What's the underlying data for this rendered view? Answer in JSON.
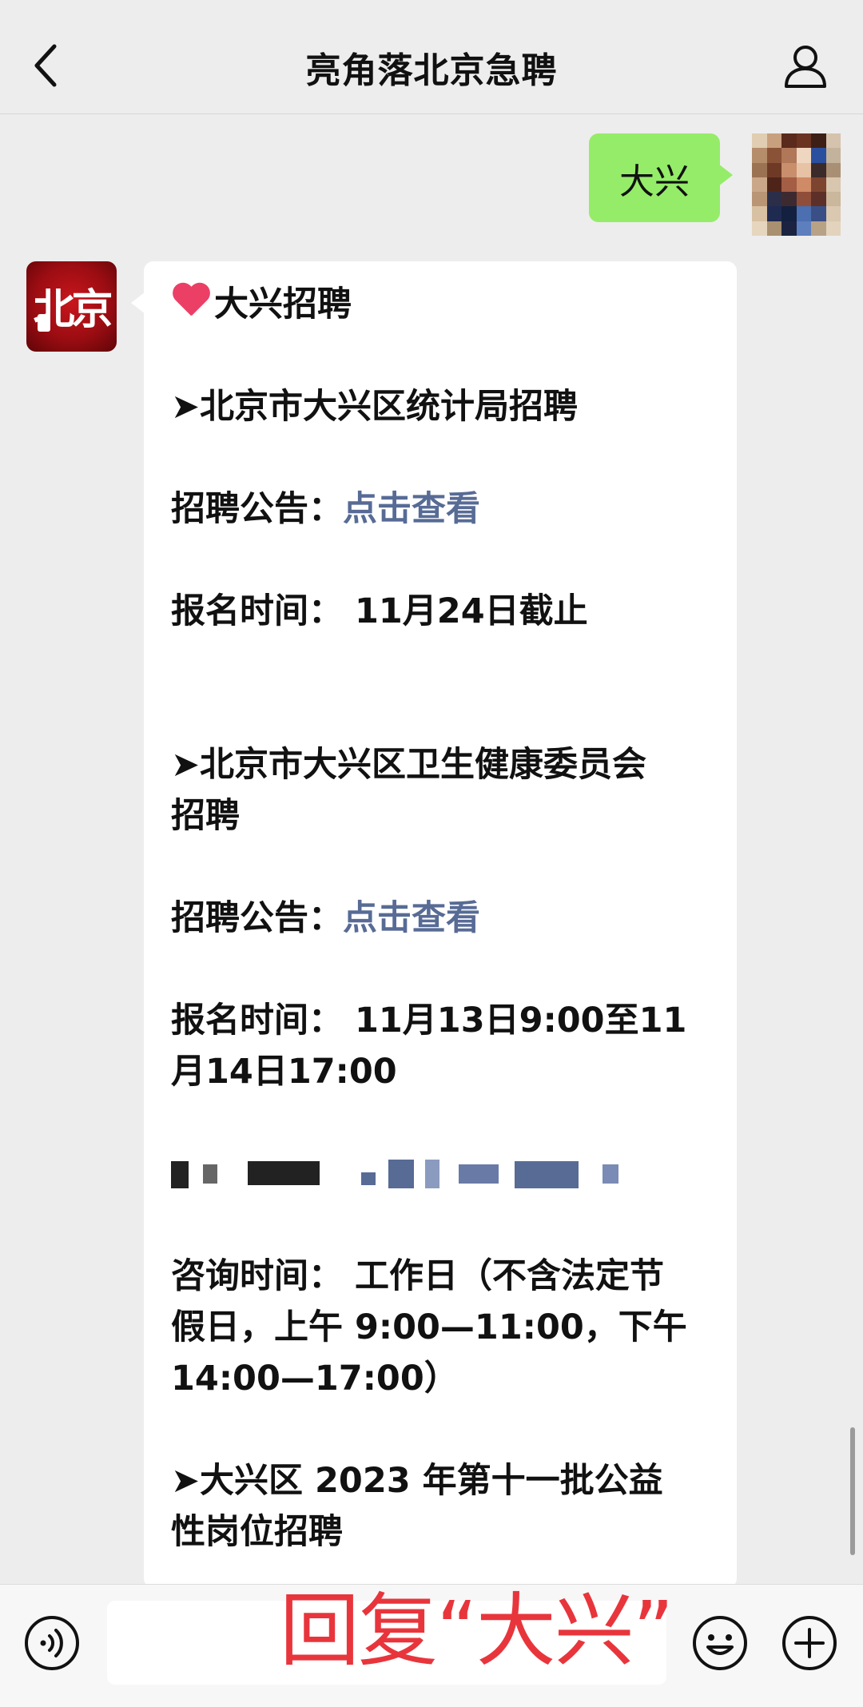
{
  "header": {
    "title": "亮角落北京急聘",
    "back_icon": "chevron-left-icon",
    "profile_icon": "person-icon"
  },
  "chat": {
    "outgoing": {
      "text": "大兴",
      "bubble_color": "#95ec69"
    },
    "incoming": {
      "sender_logo_text": "北京",
      "sender_logo_color": "#b00e14",
      "title": "大兴招聘",
      "sections": [
        {
          "heading": "➤北京市大兴区统计局招聘",
          "notice_label": "招聘公告：",
          "notice_link": "点击查看",
          "signup": "报名时间：  11月24日截止"
        },
        {
          "heading_line1": "➤北京市大兴区卫生健康委员会",
          "heading_line2": "招聘",
          "notice_label": "招聘公告：",
          "notice_link": "点击查看",
          "signup_line1": "报名时间：  11月13日9:00至11",
          "signup_line2": "月14日17:00",
          "consult_line1": "咨询时间：  工作日（不含法定节",
          "consult_line2": "假日，上午 9:00—11:00，下午",
          "consult_line3": "14:00—17:00）"
        },
        {
          "heading_line1": "➤大兴区 2023 年第十一批公益",
          "heading_line2": "性岗位招聘"
        }
      ],
      "link_color": "#576b95"
    }
  },
  "input_bar": {
    "placeholder": "",
    "overlay_text": "回复“大兴”",
    "overlay_color": "#e8353c"
  }
}
